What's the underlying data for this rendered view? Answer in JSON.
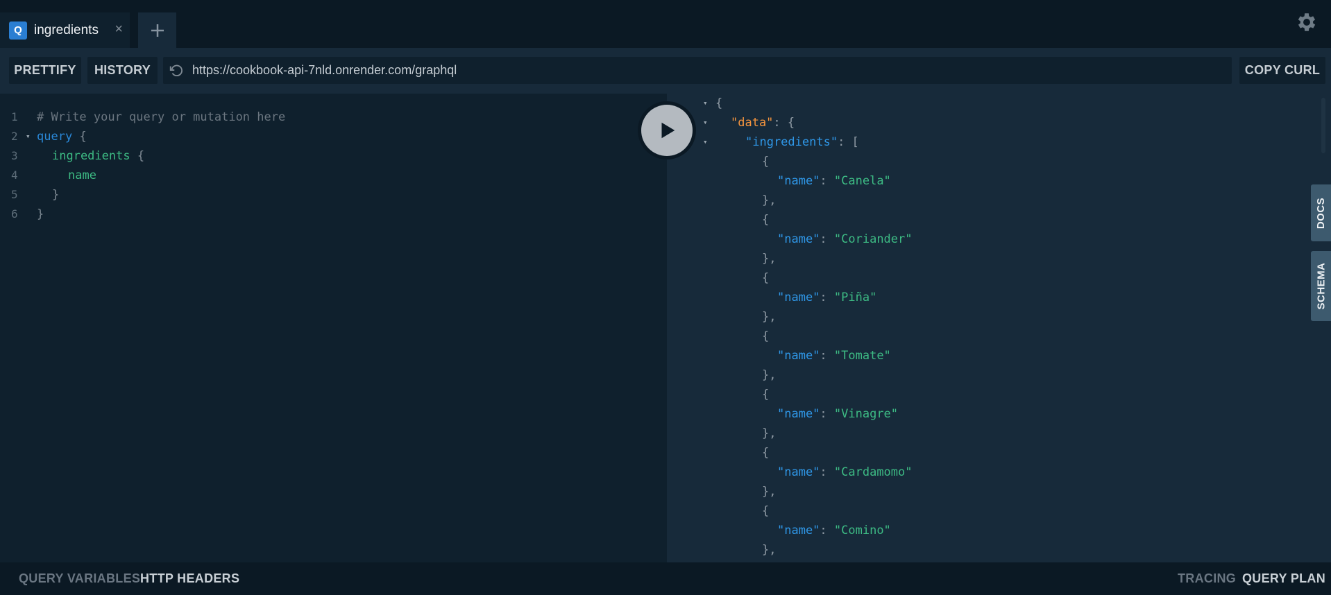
{
  "tabs": [
    {
      "badge": "Q",
      "label": "ingredients",
      "close": "×"
    }
  ],
  "add_tab_icon": "plus-icon",
  "settings_icon": "gear-icon",
  "toolbar": {
    "prettify_label": "PRETTIFY",
    "history_label": "HISTORY",
    "endpoint_url": "https://cookbook-api-7nld.onrender.com/graphql",
    "copy_curl_label": "COPY CURL"
  },
  "editor": {
    "line_numbers": [
      "1",
      "2",
      "3",
      "4",
      "5",
      "6"
    ],
    "comment": "# Write your query or mutation here",
    "keyword": "query",
    "field": "ingredients",
    "subfield": "name",
    "open_brace": "{",
    "close_brace": "}"
  },
  "result": {
    "root_key": "\"data\"",
    "list_key": "\"ingredients\"",
    "item_key": "\"name\"",
    "names": [
      "\"Canela\"",
      "\"Coriander\"",
      "\"Piña\"",
      "\"Tomate\"",
      "\"Vinagre\"",
      "\"Cardamomo\"",
      "\"Comino\""
    ]
  },
  "side_tabs": {
    "docs": "DOCS",
    "schema": "SCHEMA"
  },
  "bottom": {
    "query_variables": "QUERY VARIABLES",
    "http_headers": "HTTP HEADERS",
    "tracing": "TRACING",
    "query_plan": "QUERY PLAN"
  },
  "colors": {
    "background": "#0f202d",
    "panel": "#172a3a",
    "accent": "#2a7ed2",
    "string": "#3dbb84",
    "key": "#2f97e7",
    "data_key": "#f5943e"
  }
}
